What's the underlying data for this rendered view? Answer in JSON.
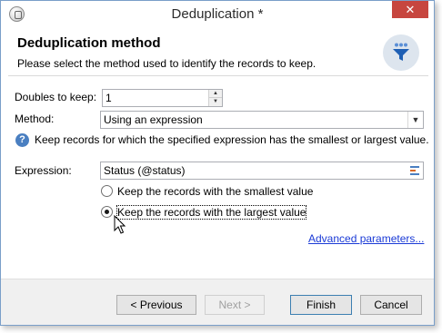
{
  "window": {
    "title": "Deduplication *",
    "close_label": "✕"
  },
  "header": {
    "title": "Deduplication method",
    "subtitle": "Please select the method used to identify the records to keep."
  },
  "form": {
    "doubles_label": "Doubles to keep:",
    "doubles_value": "1",
    "method_label": "Method:",
    "method_value": "Using an expression",
    "help_text": "Keep records for which the specified expression has the smallest or largest value.",
    "expression_label": "Expression:",
    "expression_value": "Status (@status)",
    "radio_smallest": "Keep the records with the smallest value",
    "radio_largest": "Keep the records with the largest value",
    "selected_option": "largest",
    "advanced_link": "Advanced parameters..."
  },
  "buttons": {
    "previous": "< Previous",
    "next": "Next >",
    "finish": "Finish",
    "cancel": "Cancel"
  },
  "colors": {
    "close": "#c7463f",
    "link": "#1a3ad6",
    "help": "#4a7fc1"
  }
}
